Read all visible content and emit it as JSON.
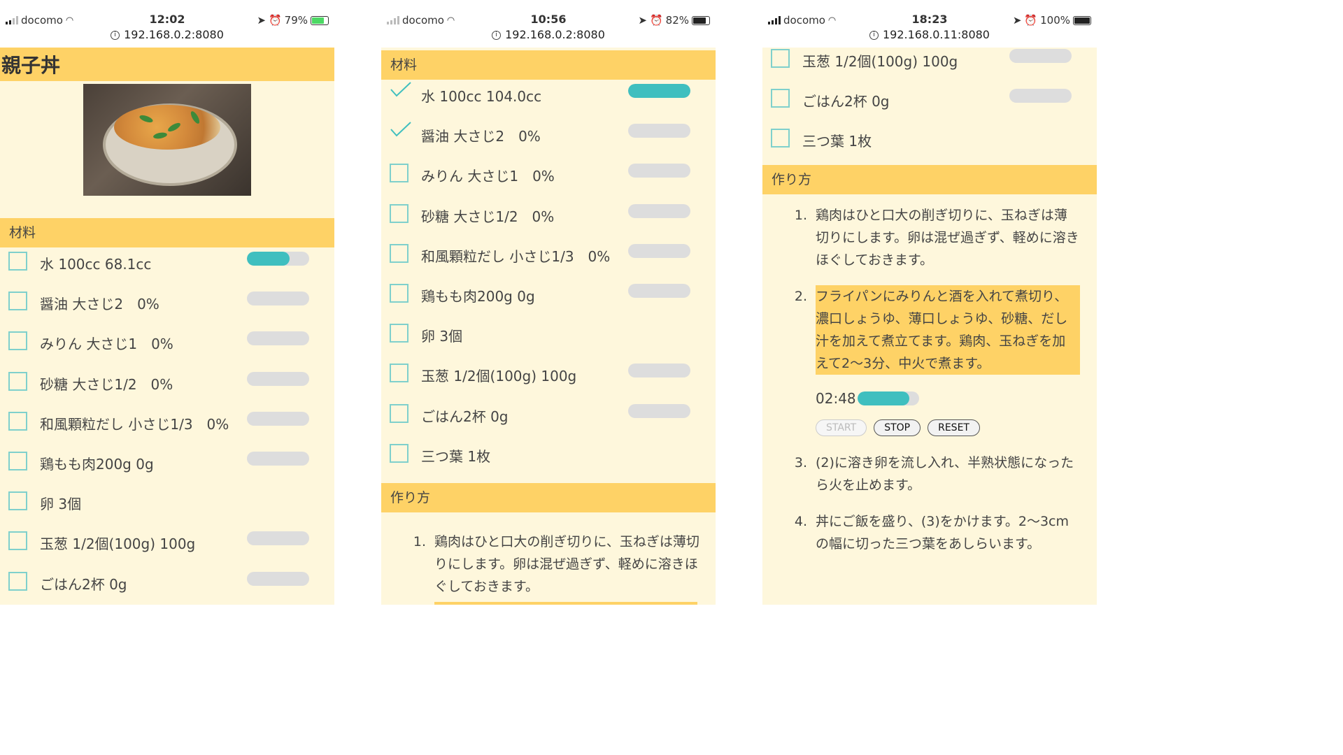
{
  "phones": [
    {
      "status": {
        "carrier": "docomo",
        "time": "12:02",
        "battery": "79%",
        "battery_level": 0.79
      },
      "url": "192.168.0.2:8080",
      "title": "親子丼",
      "section_ingredients": "材料",
      "ingredients": [
        {
          "text": "水 100cc 68.1cc",
          "checked": false,
          "bar": 0.68
        },
        {
          "text": "醤油 大さじ2　0%",
          "checked": false,
          "bar": 0
        },
        {
          "text": "みりん 大さじ1　0%",
          "checked": false,
          "bar": 0
        },
        {
          "text": "砂糖 大さじ1/2　0%",
          "checked": false,
          "bar": 0
        },
        {
          "text": "和風顆粒だし 小さじ1/3　0%",
          "checked": false,
          "bar": 0
        },
        {
          "text": "鶏もも肉200g 0g",
          "checked": false,
          "bar": 0
        },
        {
          "text": "卵 3個",
          "checked": false,
          "bar": null
        },
        {
          "text": "玉葱 1/2個(100g) 100g",
          "checked": false,
          "bar": 0
        },
        {
          "text": "ごはん2杯 0g",
          "checked": false,
          "bar": 0
        }
      ]
    },
    {
      "status": {
        "carrier": "docomo",
        "time": "10:56",
        "battery": "82%",
        "battery_level": 0.82
      },
      "url": "192.168.0.2:8080",
      "section_ingredients": "材料",
      "ingredients": [
        {
          "text": "水 100cc 104.0cc",
          "checked": true,
          "bar": 1.0
        },
        {
          "text": "醤油 大さじ2　0%",
          "checked": true,
          "bar": 0
        },
        {
          "text": "みりん 大さじ1　0%",
          "checked": false,
          "bar": 0
        },
        {
          "text": "砂糖 大さじ1/2　0%",
          "checked": false,
          "bar": 0
        },
        {
          "text": "和風顆粒だし 小さじ1/3　0%",
          "checked": false,
          "bar": 0
        },
        {
          "text": "鶏もも肉200g 0g",
          "checked": false,
          "bar": 0
        },
        {
          "text": "卵 3個",
          "checked": false,
          "bar": null
        },
        {
          "text": "玉葱 1/2個(100g) 100g",
          "checked": false,
          "bar": 0
        },
        {
          "text": "ごはん2杯 0g",
          "checked": false,
          "bar": 0
        },
        {
          "text": "三つ葉 1枚",
          "checked": false,
          "bar": null
        }
      ],
      "section_steps": "作り方",
      "steps": [
        {
          "num": "1.",
          "text": "鶏肉はひと口大の削ぎ切りに、玉ねぎは薄切りにします。卵は混ぜ過ぎず、軽めに溶きほぐしておきます。"
        }
      ]
    },
    {
      "status": {
        "carrier": "docomo",
        "time": "18:23",
        "battery": "100%",
        "battery_level": 1.0
      },
      "url": "192.168.0.11:8080",
      "ingredients": [
        {
          "text": "玉葱 1/2個(100g) 100g",
          "checked": false,
          "bar": 0
        },
        {
          "text": "ごはん2杯 0g",
          "checked": false,
          "bar": 0
        },
        {
          "text": "三つ葉 1枚",
          "checked": false,
          "bar": null
        }
      ],
      "section_steps": "作り方",
      "steps": [
        {
          "num": "1.",
          "text": "鶏肉はひと口大の削ぎ切りに、玉ねぎは薄切りにします。卵は混ぜ過ぎず、軽めに溶きほぐしておきます。"
        },
        {
          "num": "2.",
          "text": "フライパンにみりんと酒を入れて煮切り、濃口しょうゆ、薄口しょうゆ、砂糖、だし汁を加えて煮立てます。鶏肉、玉ねぎを加えて2〜3分、中火で煮ます。",
          "highlight": true
        },
        {
          "num": "3.",
          "text": "(2)に溶き卵を流し入れ、半熟状態になったら火を止めます。"
        },
        {
          "num": "4.",
          "text": "丼にご飯を盛り、(3)をかけます。2〜3cmの幅に切った三つ葉をあしらいます。"
        }
      ],
      "timer": {
        "time": "02:48",
        "level": 0.85
      },
      "buttons": {
        "start": "START",
        "stop": "STOP",
        "reset": "RESET"
      }
    }
  ],
  "colors": {
    "header": "#fed266",
    "background": "#fef7dc",
    "accent": "#3fbfbf",
    "checkbox": "#7fd0cc"
  }
}
